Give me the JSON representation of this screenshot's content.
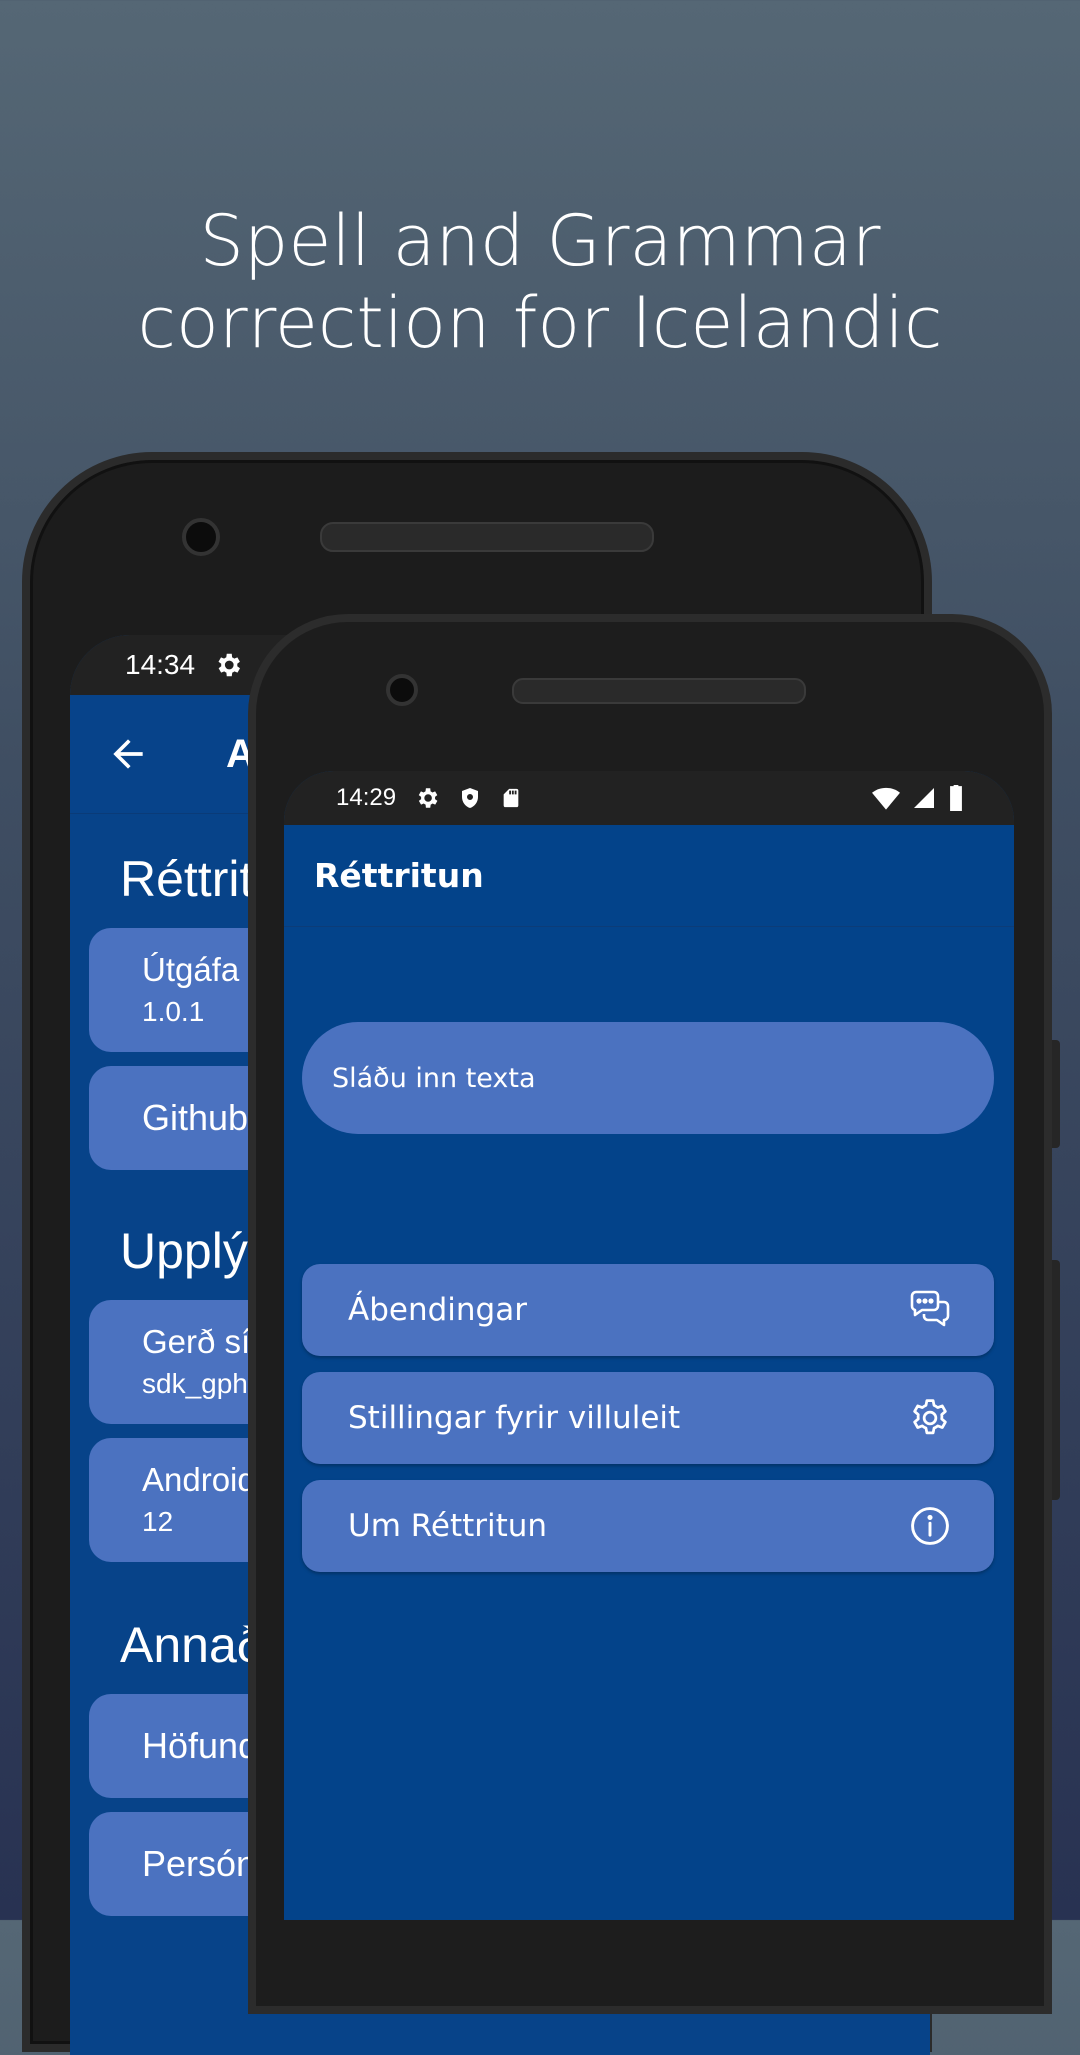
{
  "headline": {
    "line1": "Spell and Grammar",
    "line2": "correction for Icelandic"
  },
  "back_phone": {
    "status_time": "14:34",
    "appbar_title": "Ab",
    "sections": [
      {
        "title": "Réttrit",
        "cards": [
          {
            "title": "Útgáfa",
            "subtitle": "1.0.1"
          },
          {
            "title": "Github",
            "subtitle": ""
          }
        ]
      },
      {
        "title": "Upplýs",
        "cards": [
          {
            "title": "Gerð sím",
            "subtitle": "sdk_gpho"
          },
          {
            "title": "Android",
            "subtitle": "12"
          }
        ]
      },
      {
        "title": "Annað",
        "cards": [
          {
            "title": "Höfund",
            "subtitle": ""
          },
          {
            "title": "Persón",
            "subtitle": ""
          }
        ]
      }
    ]
  },
  "front_phone": {
    "status_time": "14:29",
    "status_icons_left": [
      "settings-icon",
      "shield-icon",
      "sd-card-icon"
    ],
    "status_icons_right": [
      "wifi-icon",
      "signal-icon",
      "battery-icon"
    ],
    "appbar_title": "Réttritun",
    "input_placeholder": "Sláðu inn texta",
    "menu": [
      {
        "label": "Ábendingar",
        "icon": "chat-bubbles-icon"
      },
      {
        "label": "Stillingar fyrir villuleit",
        "icon": "gear-icon"
      },
      {
        "label": "Um Réttritun",
        "icon": "info-icon"
      }
    ]
  },
  "colors": {
    "app_background": "#03438a",
    "card": "#4b72c0",
    "status_bar": "#222222",
    "text": "#ffffff"
  }
}
